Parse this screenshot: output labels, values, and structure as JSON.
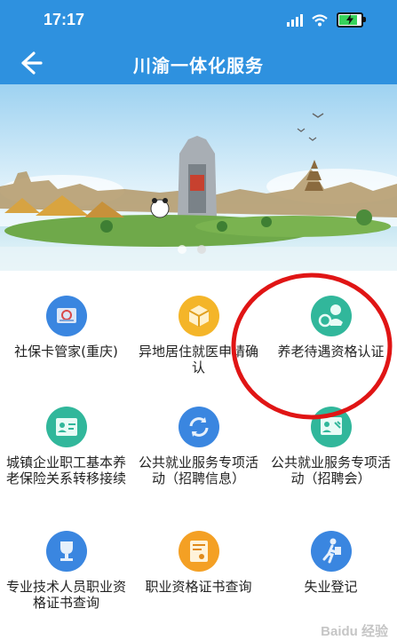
{
  "status_bar": {
    "time": "17:17"
  },
  "header": {
    "title": "川渝一体化服务",
    "back_icon": "arrow-left-icon"
  },
  "banner": {
    "slides": 2,
    "active_slide": 1
  },
  "services": [
    {
      "label": "社保卡管家(重庆)",
      "icon": "id-card-icon",
      "color": "#3a86e0"
    },
    {
      "label": "异地居住就医申请确认",
      "icon": "box-icon",
      "color": "#f4b529"
    },
    {
      "label": "养老待遇资格认证",
      "icon": "elder-care-icon",
      "color": "#31b79b"
    },
    {
      "label": "城镇企业职工基本养老保险关系转移接续",
      "icon": "profile-card-icon",
      "color": "#31b79b"
    },
    {
      "label": "公共就业服务专项活动（招聘信息）",
      "icon": "refresh-icon",
      "color": "#3a86e0"
    },
    {
      "label": "公共就业服务专项活动（招聘会）",
      "icon": "presentation-icon",
      "color": "#31b79b"
    },
    {
      "label": "专业技术人员职业资格证书查询",
      "icon": "trophy-icon",
      "color": "#3a86e0"
    },
    {
      "label": "职业资格证书查询",
      "icon": "certificate-icon",
      "color": "#f4a024"
    },
    {
      "label": "失业登记",
      "icon": "walking-person-icon",
      "color": "#3a86e0"
    }
  ],
  "watermark": "Baidu 经验"
}
